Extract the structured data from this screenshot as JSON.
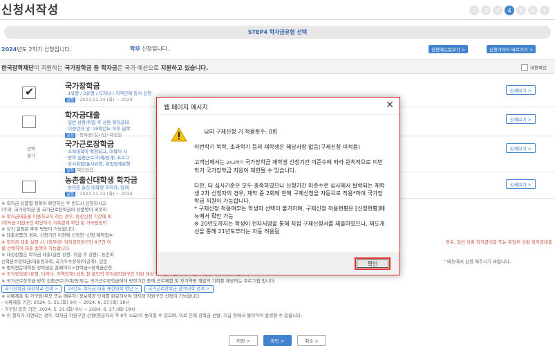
{
  "page": {
    "title": "신청서작성"
  },
  "steps": [
    "1",
    "2",
    "3",
    "4",
    "5",
    "6",
    "7"
  ],
  "step_active_index": 3,
  "step_banner": "STEP4 학자금유형 선택",
  "info": {
    "year_bold": "2024",
    "year_rest": "년도 2학기 신청입니다.",
    "dept_bold": "학부",
    "dept_rest": " 신청입니다.",
    "guide_manual": "신청매뉴얼보기 >",
    "guide_shortcut": "신청가이드 바로가기 >"
  },
  "notice": {
    "part1": "한국장학재단",
    "part2": "이 지원하는 ",
    "part3": "국가장학금 등 학자금",
    "part4": "은 국가 예산으로 ",
    "part5": "지원하고 있습니다.",
    "detail_label": "내용확인"
  },
  "types": [
    {
      "name": "국가장학금",
      "line1": "· 1유형 / 2유형 / 다자녀 / 지역인재 동시 신청",
      "tag": "일정",
      "line2": "· 2023.11.14.(화) ~ 2024",
      "selected": true,
      "sel_text": "",
      "detail": "상세보기 >"
    },
    {
      "name": "학자금대출",
      "line1": "· 일반 상환/취업 후 상환 학자금대",
      "line2a": "· 미성년자 및 '19학년도 이후 입학",
      "tag": "일정",
      "line2": "· 등록금(실시납) 예정일",
      "selected": false,
      "sel_text": "",
      "detail": "상세보기 >"
    },
    {
      "name": "국가근로장학금",
      "line1": "· 소속대학이 확정되고, 대학이 시",
      "line2a": "· 방학 집중근로(하계/동계) 프로그",
      "line2b": "· 상시취업(통사유형, 취업연계유형",
      "tag": "일정",
      "line2": "해당없음",
      "selected": false,
      "sel_text": "선택\n불가",
      "detail": "상세보기 >"
    },
    {
      "name": "농촌출신대학생 학자금",
      "line1": "· 농어촌 출신 대학생 무이자, 당해",
      "tag": "일정",
      "line2": "· 2024.11.14.(화) ~ 2024",
      "selected": false,
      "sel_text": "",
      "detail": "상세보기 >"
    }
  ],
  "notes": [
    "※ 학자금 상품별 정확히 확인하신 후 반드시 신청하시고",
    "(주의: 국가장학금 및 국가근로장학금의 상품명이 비슷하",
    "※ 학자금대출을 이용하고자 하는 경우, 등장신청 기간에 미",
    "(학자금 지원구간 확인하기 가족관계 확인 및 가구원동의",
    "※ 상기 일정은 추후 변동이 가능합니다.",
    "※ 대출상품의 경우, 신청기간 이전에 신청한 '신청 예약접수",
    "※ 학자금 대출 실행 시, (학부생) 학자금지원구간 8구간 이",
    "을 선택하여 대출 실행이 가능합니다.",
    "※ 대상상품은 학자금 대출(일반 상환, 취업 후 상환), 농촌학",
    "신학분수장학금(대통령과학, 국가우수장학(이공계), 인문",
    "※ 법학전문대학원 장학금은 홈페이지>장학금>장학금신청",
    "※ 국가장학금(I유형, 다자녀, 지역인재) 신청 전 본인의 학자금지원구간 지원 대상 학교인지 검색 해 보신 후 신청 해 주시기 바랍니다.",
    "※ 국가근로장학금 방학 집중근로(하계/동계)는 국가근로장학금에게 방학기간 중에 근로체험 및 자기역량 계발의 기회를 제공하는 프로그램 입니다."
  ],
  "notes_right": [
    "경우, 일반 상환 학자금대출 또는 취업후 상환 학자금대출",
    "'' 메뉴에서 신청 해주시기 바랍니다."
  ],
  "note_links": [
    "국가장학금 대상학교 검색 >",
    "24년도 학자금 대출 제한대학 명단 >",
    "국가근로장학금 참여대학 검색 >"
  ],
  "notes_tail": [
    "※ 서류제출 및 가구원(부모 또는 배우자) 정보제공 단계를 완료하셔야 학자금 지원구간 산정이 가능합니다",
    "- 서류제출 기간: 2024. 5. 21.(화) 9시 ~ 2024. 6. 27.(목) 18시",
    "- 가구원 동의 기간: 2024. 5. 21.(화) 9시 ~ 2024. 6. 27.(목) 18시",
    "※ 위 절차가 지연되는 경우, 학자금 지원구간 산정(평균처리 약 8주 소요)이 늦어질 수 있으며, 이로 인해 장학금 선발, 지급 등에서 불이익이 발생할 수 있습니다."
  ],
  "bottom": {
    "prev": "이전 >",
    "next": "확인 >",
    "cancel": "취소 >"
  },
  "dialog": {
    "title": "웹 페이지 메시지",
    "close": "✕",
    "line_count": "님의 구제신청 기 적용횟수: 0회",
    "line_p1": "이번학기 복학, 초과학기 등의 재학생은 해당사항 없음(구제신청 미적용)",
    "line_p2a": "고객님께서는 ",
    "line_p2b": "24.2학기",
    "line_p2c": " 국가장학금 재학생 신청기간 미준수에 따라 원칙적으로 이번 학기 국가장학금 지원이 제한될 수 있습니다.",
    "line_p3": "다만, 타 심사기준은 모두 충족하였으나 신청기간 미준수로 심사에서 탈락되는 재학생 2차 신청자의 경우, 재학 중 2회에 한해 구제신청을 자동으로 적용*하여 국가장학금 지원이 가능합니다.",
    "line_p4": "* 구제신청 적용여부는 학생의 선택이 불가하며, 구제신청 적용현황은 [신청현황]메뉴에서 확인 가능",
    "line_p5": "※ 20년도까지는 학생이 전자서명을 통해 직접 구제신청서를 제출하였으나, 제도개선을 통해 21년도부터는 자동 적용됨",
    "ok": "확인"
  },
  "colors": {
    "accent": "#2a73c9",
    "title_blue": "#1f4fa6",
    "alert_red": "#e03030"
  }
}
